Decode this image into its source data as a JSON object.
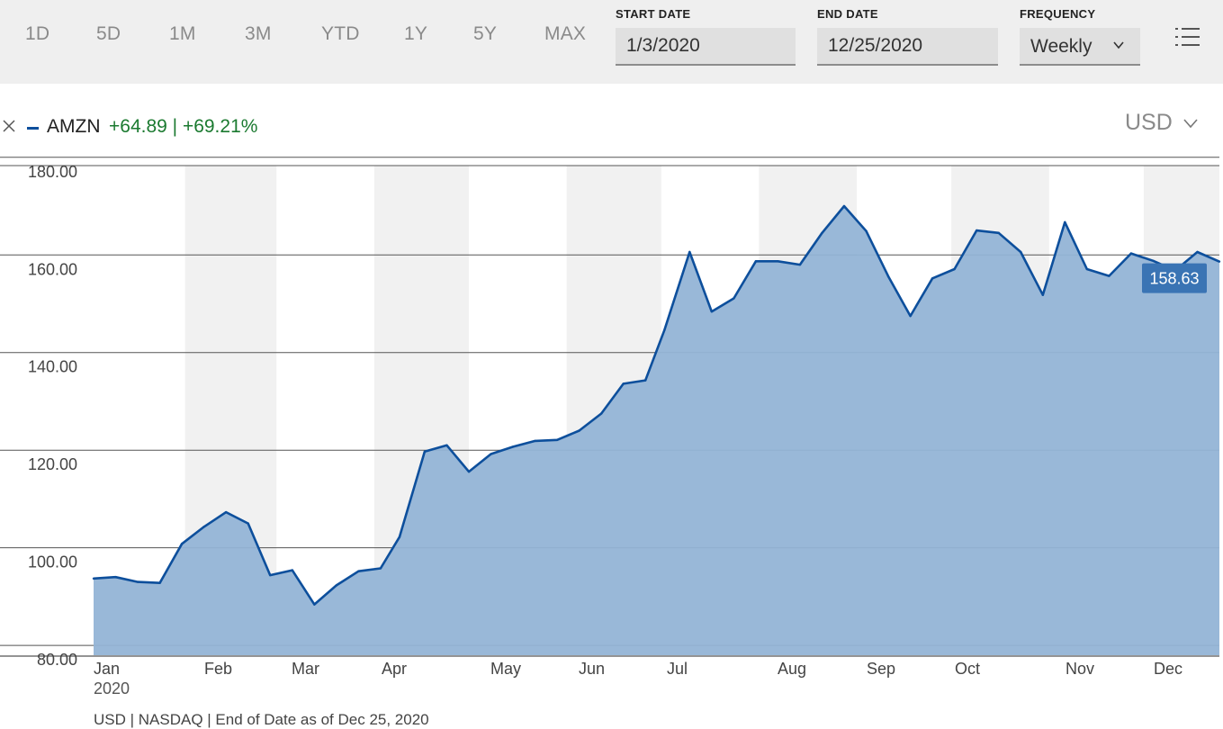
{
  "toolbar": {
    "ranges": [
      "1D",
      "5D",
      "1M",
      "3M",
      "YTD",
      "1Y",
      "5Y",
      "MAX"
    ],
    "start_date_label": "START DATE",
    "start_date_value": "1/3/2020",
    "end_date_label": "END DATE",
    "end_date_value": "12/25/2020",
    "frequency_label": "FREQUENCY",
    "frequency_value": "Weekly",
    "menu_icon": "list-menu-icon"
  },
  "legend": {
    "close_icon": "close-icon",
    "ticker": "AMZN",
    "change": "+64.89 | +69.21%",
    "change_color": "#1b7a30",
    "series_color": "#0d4f9c"
  },
  "currency_selector": {
    "value": "USD",
    "icon": "chevron-down-icon"
  },
  "footer": "USD | NASDAQ | End of Date as of Dec 25, 2020",
  "chart_data": {
    "type": "area",
    "series": [
      {
        "name": "AMZN",
        "color": "#0d4f9c",
        "fill": "#93b4d6",
        "x": [
          "2020-01-03",
          "2020-01-10",
          "2020-01-17",
          "2020-01-24",
          "2020-01-31",
          "2020-02-07",
          "2020-02-14",
          "2020-02-21",
          "2020-02-28",
          "2020-03-06",
          "2020-03-13",
          "2020-03-20",
          "2020-03-27",
          "2020-04-03",
          "2020-04-09",
          "2020-04-17",
          "2020-04-24",
          "2020-05-01",
          "2020-05-08",
          "2020-05-15",
          "2020-05-22",
          "2020-05-29",
          "2020-06-05",
          "2020-06-12",
          "2020-06-19",
          "2020-06-26",
          "2020-07-02",
          "2020-07-10",
          "2020-07-17",
          "2020-07-24",
          "2020-07-31",
          "2020-08-07",
          "2020-08-14",
          "2020-08-21",
          "2020-08-28",
          "2020-09-04",
          "2020-09-11",
          "2020-09-18",
          "2020-09-25",
          "2020-10-02",
          "2020-10-09",
          "2020-10-16",
          "2020-10-23",
          "2020-10-30",
          "2020-11-06",
          "2020-11-13",
          "2020-11-20",
          "2020-11-27",
          "2020-12-04",
          "2020-12-11",
          "2020-12-18",
          "2020-12-25"
        ],
        "values": [
          93.7,
          94.0,
          93.0,
          92.8,
          100.8,
          104.3,
          107.3,
          105.0,
          94.4,
          95.4,
          88.4,
          92.3,
          95.2,
          95.8,
          102.2,
          119.7,
          121.0,
          115.6,
          119.2,
          120.7,
          121.9,
          122.1,
          124.0,
          127.5,
          133.6,
          134.3,
          144.6,
          160.6,
          148.4,
          151.1,
          158.7,
          158.7,
          158.0,
          164.5,
          170.0,
          164.9,
          155.6,
          147.5,
          155.2,
          157.1,
          165.0,
          164.5,
          160.6,
          151.8,
          166.7,
          157.1,
          155.7,
          160.3,
          158.8,
          156.8,
          160.6,
          158.63
        ]
      }
    ],
    "y_ticks": [
      "80.00",
      "100.00",
      "120.00",
      "140.00",
      "160.00",
      "180.00"
    ],
    "x_tick_labels": [
      "Jan",
      "Feb",
      "Mar",
      "Apr",
      "May",
      "Jun",
      "Jul",
      "Aug",
      "Sep",
      "Oct",
      "Nov",
      "Dec"
    ],
    "x_year_label": "2020",
    "ylim": [
      78,
      178.3
    ],
    "last_value_label": "158.63",
    "gridlines": "horizontal",
    "month_bands": "alternating shaded"
  }
}
